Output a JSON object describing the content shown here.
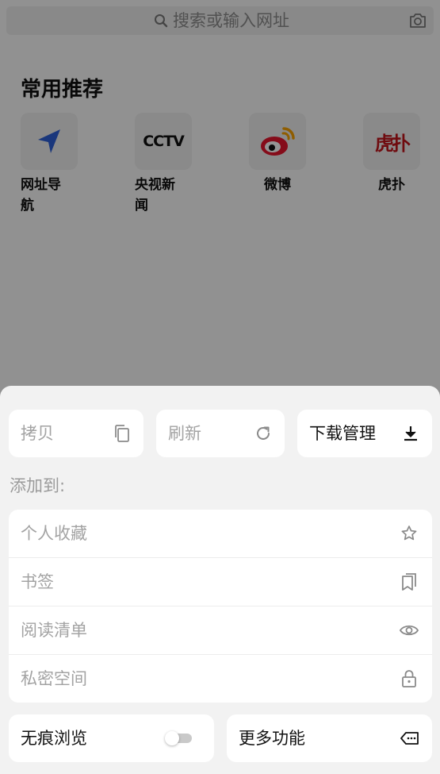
{
  "search": {
    "placeholder": "搜索或输入网址"
  },
  "recommend": {
    "title": "常用推荐",
    "apps": [
      {
        "label": "网址导航",
        "icon": "navigation-arrow-icon"
      },
      {
        "label": "央视新闻",
        "icon": "cctv-logo-icon",
        "logo_text": "CCTV"
      },
      {
        "label": "微博",
        "icon": "weibo-logo-icon"
      },
      {
        "label": "虎扑",
        "icon": "hupu-logo-icon",
        "logo_text": "虎扑"
      }
    ]
  },
  "sheet": {
    "copy_label": "拷贝",
    "refresh_label": "刷新",
    "download_label": "下载管理",
    "add_to_label": "添加到:",
    "add_items": [
      {
        "label": "个人收藏",
        "icon": "star-icon"
      },
      {
        "label": "书签",
        "icon": "bookmark-icon"
      },
      {
        "label": "阅读清单",
        "icon": "eye-icon"
      },
      {
        "label": "私密空间",
        "icon": "lock-icon"
      }
    ],
    "incognito_label": "无痕浏览",
    "incognito_on": false,
    "more_label": "更多功能"
  },
  "colors": {
    "accent_blue": "#2e5fd6",
    "weibo_red": "#e6162d",
    "hupu_red": "#c0141a",
    "dim_overlay": "rgba(0,0,0,0.42)"
  }
}
